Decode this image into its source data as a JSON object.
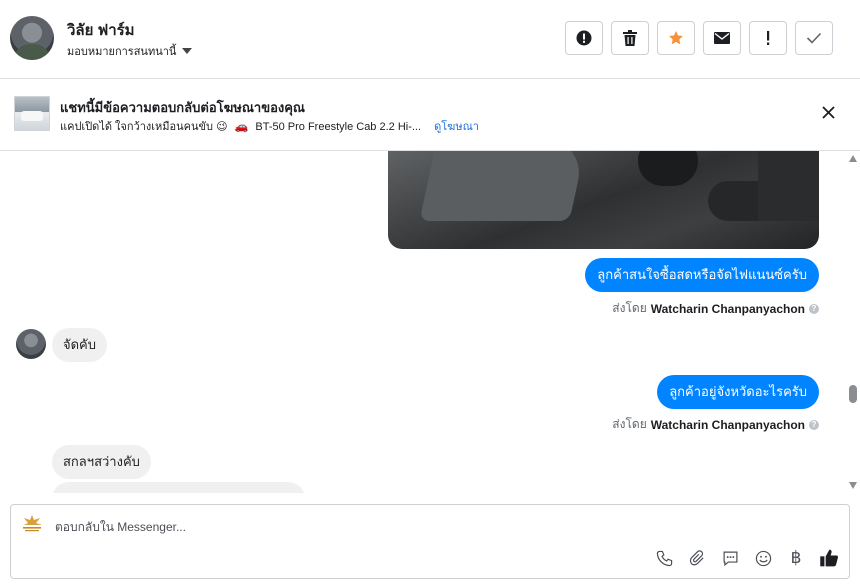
{
  "header": {
    "user_name": "วิลัย ฟาร์ม",
    "assign_label": "มอบหมายการสนทนานี้",
    "action_icons": [
      "spam-icon",
      "trash-icon",
      "star-icon",
      "envelope-icon",
      "exclamation-icon",
      "check-icon"
    ],
    "star_color": "#f7923b"
  },
  "ad": {
    "title": "แชทนี้มีข้อความตอบกลับต่อโฆษณาของคุณ",
    "subtitle_prefix": "แคปเปิดได้ ใจกว้างเหมือนคนขับ 😉",
    "car_emoji": "🚗",
    "subtitle_ad": "BT-50 Pro Freestyle Cab 2.2 Hi-...",
    "link": "ดูโฆษณา"
  },
  "conversation": {
    "messages": [
      {
        "text": "ลูกค้าสนใจซื้อสดหรือจัดไฟแนนซ์ครับ"
      },
      {
        "sent_by_prefix": "ส่งโดย",
        "sent_by_name": "Watcharin Chanpanyachon"
      },
      {
        "text": "จัดคับ"
      },
      {
        "text": "ลูกค้าอยู่จังหวัดอะไรครับ"
      },
      {
        "sent_by_prefix": "ส่งโดย",
        "sent_by_name": "Watcharin Chanpanyachon"
      },
      {
        "text": "สกลฯสว่างคับ"
      }
    ],
    "outgoing_color": "#0084ff",
    "incoming_color": "#f1f0f0"
  },
  "composer": {
    "placeholder": "ตอบกลับใน Messenger...",
    "tool_icons": [
      "phone-icon",
      "paperclip-icon",
      "saved-reply-icon",
      "emoji-icon",
      "baht-icon",
      "like-icon"
    ],
    "baht_symbol": "฿"
  }
}
